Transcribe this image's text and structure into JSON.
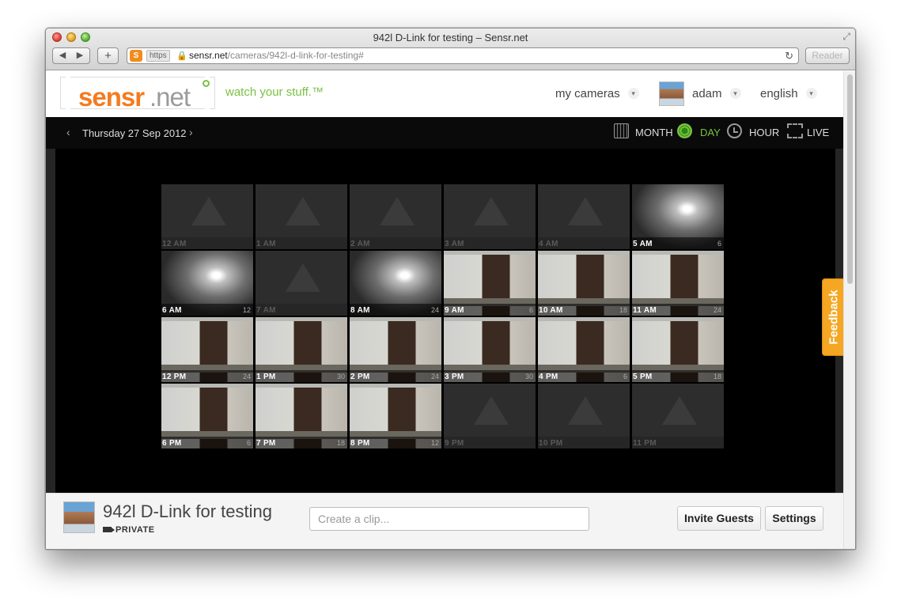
{
  "window": {
    "title": "942l D-Link for testing – Sensr.net",
    "url_scheme": "https",
    "url_host": "sensr.net",
    "url_path": "/cameras/942l-d-link-for-testing#",
    "reader_label": "Reader",
    "favicon_letter": "S",
    "back_glyph": "◀",
    "forward_glyph": "▶",
    "add_glyph": "+",
    "reload_glyph": "↻",
    "lock_glyph": "🔒",
    "fullscreen_glyph": "⤢"
  },
  "header": {
    "logo_sensr": "sensr",
    "logo_net": ".net",
    "tagline": "watch your stuff.™",
    "nav": {
      "cameras": "my cameras",
      "user": "adam",
      "language": "english"
    },
    "caret_glyph": "▾"
  },
  "viewer": {
    "prev_glyph": "‹",
    "next_glyph": "›",
    "date": "Thursday 27 Sep 2012",
    "modes": {
      "month": "MONTH",
      "day": "DAY",
      "hour": "HOUR",
      "live": "LIVE"
    },
    "active_mode": "day",
    "tiles": [
      {
        "label": "12 AM",
        "count": "",
        "kind": "empty"
      },
      {
        "label": "1 AM",
        "count": "",
        "kind": "empty"
      },
      {
        "label": "2 AM",
        "count": "",
        "kind": "empty"
      },
      {
        "label": "3 AM",
        "count": "",
        "kind": "empty"
      },
      {
        "label": "4 AM",
        "count": "",
        "kind": "empty"
      },
      {
        "label": "5 AM",
        "count": "6",
        "kind": "dark"
      },
      {
        "label": "6 AM",
        "count": "12",
        "kind": "dark"
      },
      {
        "label": "7 AM",
        "count": "",
        "kind": "empty"
      },
      {
        "label": "8 AM",
        "count": "24",
        "kind": "dark"
      },
      {
        "label": "9 AM",
        "count": "6",
        "kind": "office"
      },
      {
        "label": "10 AM",
        "count": "18",
        "kind": "office"
      },
      {
        "label": "11 AM",
        "count": "24",
        "kind": "office"
      },
      {
        "label": "12 PM",
        "count": "24",
        "kind": "office"
      },
      {
        "label": "1 PM",
        "count": "30",
        "kind": "office"
      },
      {
        "label": "2 PM",
        "count": "24",
        "kind": "office"
      },
      {
        "label": "3 PM",
        "count": "30",
        "kind": "office"
      },
      {
        "label": "4 PM",
        "count": "6",
        "kind": "office"
      },
      {
        "label": "5 PM",
        "count": "18",
        "kind": "office"
      },
      {
        "label": "6 PM",
        "count": "6",
        "kind": "office"
      },
      {
        "label": "7 PM",
        "count": "18",
        "kind": "office"
      },
      {
        "label": "8 PM",
        "count": "12",
        "kind": "office"
      },
      {
        "label": "9 PM",
        "count": "",
        "kind": "empty"
      },
      {
        "label": "10 PM",
        "count": "",
        "kind": "empty"
      },
      {
        "label": "11 PM",
        "count": "",
        "kind": "empty"
      }
    ],
    "feedback_label": "Feedback"
  },
  "footer": {
    "camera_name": "942l D-Link for testing",
    "privacy": "PRIVATE",
    "clip_placeholder": "Create a clip...",
    "invite_label": "Invite Guests",
    "settings_label": "Settings"
  },
  "colors": {
    "brand_orange": "#f47b20",
    "brand_green": "#7ac143",
    "feedback": "#f5a623"
  }
}
